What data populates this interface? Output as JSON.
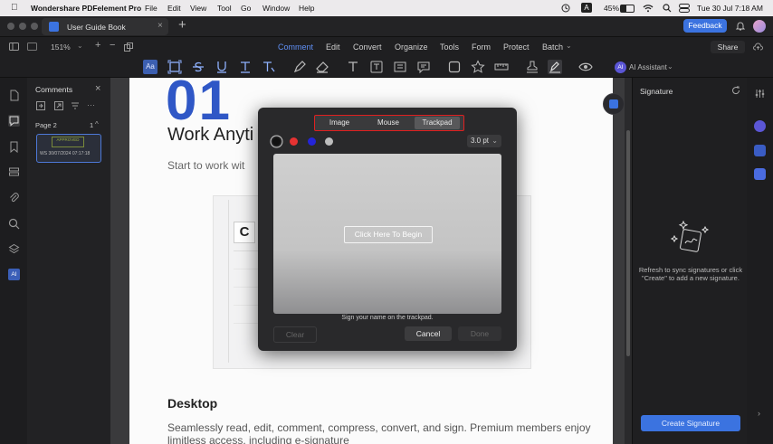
{
  "menubar": {
    "app_name": "Wondershare PDFelement Pro",
    "menus": [
      "File",
      "Edit",
      "View",
      "Tool",
      "Go",
      "Window",
      "Help"
    ],
    "battery": "45%",
    "datetime": "Tue 30 Jul  7:18 AM",
    "input_badge": "A"
  },
  "tabs": {
    "doc_title": "User Guide Book",
    "feedback_label": "Feedback"
  },
  "nav": {
    "zoom": "151%",
    "tabs": [
      "Comment",
      "Edit",
      "Convert",
      "Organize",
      "Tools",
      "Form",
      "Protect",
      "Batch"
    ],
    "active_tab": "Comment",
    "share_label": "Share"
  },
  "toolbar": {
    "ai_assistant": "AI Assistant",
    "ai_badge": "AI"
  },
  "comments_panel": {
    "title": "Comments",
    "page_label": "Page 2",
    "page_count": "1",
    "stamp_text": "APPROVED",
    "stamp_meta": "WS 30/07/2024 07:17:18"
  },
  "document": {
    "big_heading": "01",
    "heading": "Work Anyti",
    "subtitle": "Start to work wit",
    "section_heading": "Desktop",
    "section_text": "Seamlessly read, edit, comment, compress, convert, and sign. Premium members enjoy limitless access, including e-signature"
  },
  "signature_panel": {
    "title": "Signature",
    "empty_message": "Refresh to sync signatures or click \"Create\" to add a new signature.",
    "create_label": "Create Signature"
  },
  "dialog": {
    "modes": [
      "Image",
      "Mouse",
      "Trackpad"
    ],
    "active_mode": "Trackpad",
    "colors": [
      "#111111",
      "#e63232",
      "#2424d8",
      "#bdbdbd"
    ],
    "stroke_width": "3.0 pt",
    "begin_label": "Click Here To Begin",
    "hint": "Sign your name on the trackpad.",
    "clear_label": "Clear",
    "cancel_label": "Cancel",
    "done_label": "Done"
  },
  "rail": {
    "left_ai": "AI"
  }
}
